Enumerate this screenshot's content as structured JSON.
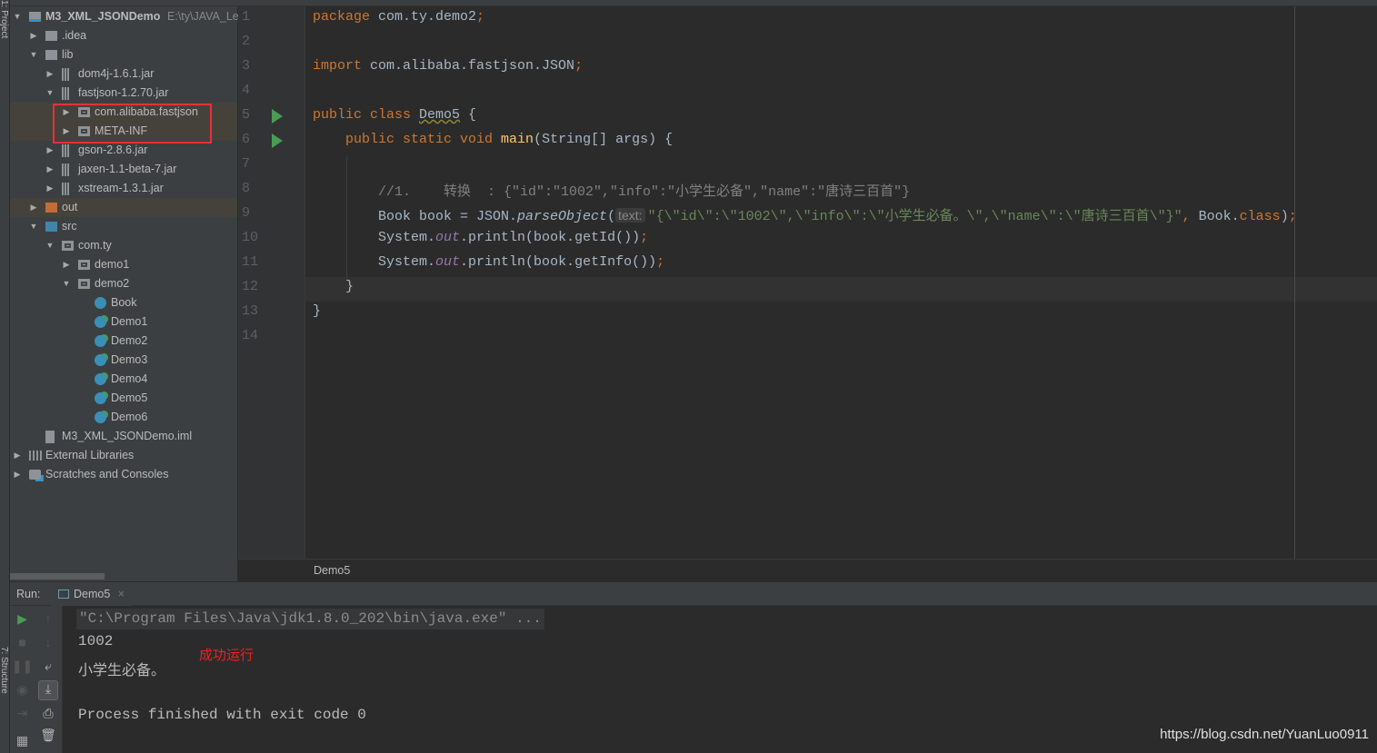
{
  "side_stripe": {
    "project_label": "1: Project",
    "structure_label": "7: Structure"
  },
  "project_tree": {
    "rows": [
      {
        "label": "M3_XML_JSONDemo",
        "path": "E:\\ty\\JAVA_Le",
        "level": 0,
        "arrow": "down",
        "icon": "module-icon",
        "bold": true
      },
      {
        "label": ".idea",
        "level": 1,
        "arrow": "right",
        "icon": "folder-icon"
      },
      {
        "label": "lib",
        "level": 1,
        "arrow": "down",
        "icon": "folder-icon"
      },
      {
        "label": "dom4j-1.6.1.jar",
        "level": 2,
        "arrow": "right",
        "icon": "jar-icon"
      },
      {
        "label": "fastjson-1.2.70.jar",
        "level": 2,
        "arrow": "down",
        "icon": "jar-icon"
      },
      {
        "label": "com.alibaba.fastjson",
        "level": 3,
        "arrow": "right",
        "icon": "package-icon",
        "highlight": true
      },
      {
        "label": "META-INF",
        "level": 3,
        "arrow": "right",
        "icon": "package-icon",
        "highlight": true
      },
      {
        "label": "gson-2.8.6.jar",
        "level": 2,
        "arrow": "right",
        "icon": "jar-icon"
      },
      {
        "label": "jaxen-1.1-beta-7.jar",
        "level": 2,
        "arrow": "right",
        "icon": "jar-icon"
      },
      {
        "label": "xstream-1.3.1.jar",
        "level": 2,
        "arrow": "right",
        "icon": "jar-icon"
      },
      {
        "label": "out",
        "level": 1,
        "arrow": "right",
        "icon": "output-folder-icon",
        "highlight": true
      },
      {
        "label": "src",
        "level": 1,
        "arrow": "down",
        "icon": "source-folder-icon"
      },
      {
        "label": "com.ty",
        "level": 2,
        "arrow": "down",
        "icon": "package-icon"
      },
      {
        "label": "demo1",
        "level": 3,
        "arrow": "right",
        "icon": "package-icon"
      },
      {
        "label": "demo2",
        "level": 3,
        "arrow": "down",
        "icon": "package-icon"
      },
      {
        "label": "Book",
        "level": 4,
        "arrow": "none",
        "icon": "class-icon"
      },
      {
        "label": "Demo1",
        "level": 4,
        "arrow": "none",
        "icon": "runnable-class-icon"
      },
      {
        "label": "Demo2",
        "level": 4,
        "arrow": "none",
        "icon": "runnable-class-icon"
      },
      {
        "label": "Demo3",
        "level": 4,
        "arrow": "none",
        "icon": "runnable-class-icon"
      },
      {
        "label": "Demo4",
        "level": 4,
        "arrow": "none",
        "icon": "runnable-class-icon"
      },
      {
        "label": "Demo5",
        "level": 4,
        "arrow": "none",
        "icon": "runnable-class-icon"
      },
      {
        "label": "Demo6",
        "level": 4,
        "arrow": "none",
        "icon": "runnable-class-icon"
      },
      {
        "label": "M3_XML_JSONDemo.iml",
        "level": 1,
        "arrow": "none",
        "icon": "iml-file-icon"
      },
      {
        "label": "External Libraries",
        "level": 0,
        "arrow": "right",
        "icon": "libraries-icon"
      },
      {
        "label": "Scratches and Consoles",
        "level": 0,
        "arrow": "right",
        "icon": "scratches-icon"
      }
    ]
  },
  "editor": {
    "lines": [
      [
        [
          "kw",
          "package "
        ],
        [
          "",
          "com.ty.demo2"
        ],
        [
          "kw",
          ";"
        ]
      ],
      [],
      [
        [
          "kw",
          "import "
        ],
        [
          "",
          "com.alibaba.fastjson.JSON"
        ],
        [
          "kw",
          ";"
        ]
      ],
      [],
      [
        [
          "kw",
          "public class "
        ],
        [
          "cls",
          "Demo5"
        ],
        [
          "",
          " {"
        ]
      ],
      [
        [
          "",
          "    "
        ],
        [
          "kw",
          "public static void "
        ],
        [
          "fn",
          "main"
        ],
        [
          "",
          "(String[] args) {"
        ]
      ],
      [],
      [
        [
          "cmt",
          "        //1.    转换  : {\"id\":\"1002\",\"info\":\"小学生必备\",\"name\":\"唐诗三百首\"}"
        ]
      ],
      [
        [
          "",
          "        Book book = JSON."
        ],
        [
          "it",
          "parseObject"
        ],
        [
          "",
          "("
        ],
        [
          "hint",
          "text:"
        ],
        [
          "str",
          "\"{\\\"id\\\":\\\"1002\\\",\\\"info\\\":\\\"小学生必备。\\\",\\\"name\\\":\\\"唐诗三百首\\\"}\""
        ],
        [
          "kw",
          ", "
        ],
        [
          "",
          "Book."
        ],
        [
          "kw",
          "class"
        ],
        [
          "",
          ")"
        ],
        [
          "kw",
          ";"
        ]
      ],
      [
        [
          "",
          "        System."
        ],
        [
          "fld",
          "out"
        ],
        [
          "",
          ".println(book.getId())"
        ],
        [
          "kw",
          ";"
        ]
      ],
      [
        [
          "",
          "        System."
        ],
        [
          "fld",
          "out"
        ],
        [
          "",
          ".println(book.getInfo())"
        ],
        [
          "kw",
          ";"
        ]
      ],
      [
        [
          "",
          "    }"
        ]
      ],
      [
        [
          "",
          "}"
        ]
      ],
      []
    ],
    "run_gutter_lines": [
      5,
      6
    ],
    "breadcrumb": "Demo5"
  },
  "run_panel": {
    "label": "Run:",
    "tab_label": "Demo5",
    "command": "\"C:\\Program Files\\Java\\jdk1.8.0_202\\bin\\java.exe\" ...",
    "output": [
      "1002",
      "小学生必备。",
      "",
      "Process finished with exit code 0"
    ],
    "annotation": "成功运行"
  },
  "watermark": "https://blog.csdn.net/YuanLuo0911",
  "colors": {
    "keyword": "#cc7832",
    "string": "#6a8759",
    "comment": "#808080",
    "run_green": "#499c54",
    "annotation_red": "#e8303a"
  }
}
